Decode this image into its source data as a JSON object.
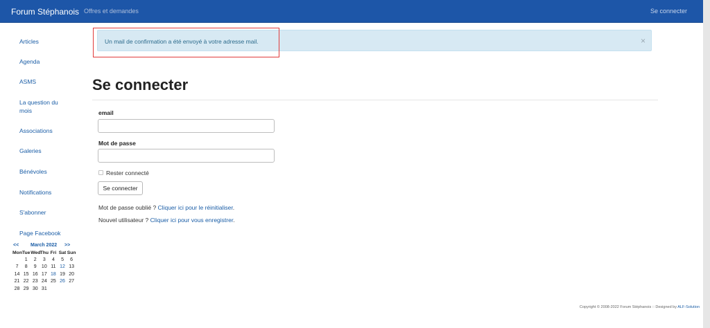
{
  "navbar": {
    "brand": "Forum Stéphanois",
    "link_offres": "Offres et demandes",
    "link_login": "Se connecter"
  },
  "sidebar": {
    "items": [
      {
        "label": "Articles"
      },
      {
        "label": "Agenda"
      },
      {
        "label": "ASMS"
      },
      {
        "label": "La question du mois"
      },
      {
        "label": "Associations"
      },
      {
        "label": "Galeries"
      },
      {
        "label": "Bénévoles"
      },
      {
        "label": "Notifications"
      },
      {
        "label": "S'abonner"
      },
      {
        "label": "Page Facebook"
      }
    ]
  },
  "calendar": {
    "prev": "<<",
    "title": "March 2022",
    "next": ">>",
    "weekdays": [
      "Mon",
      "Tue",
      "Wed",
      "Thu",
      "Fri",
      "Sat",
      "Sun"
    ],
    "weeks": [
      [
        "",
        "1",
        "2",
        "3",
        "4",
        "5",
        "6"
      ],
      [
        "7",
        "8",
        "9",
        "10",
        "11",
        "12",
        "13"
      ],
      [
        "14",
        "15",
        "16",
        "17",
        "18",
        "19",
        "20"
      ],
      [
        "21",
        "22",
        "23",
        "24",
        "25",
        "26",
        "27"
      ],
      [
        "28",
        "29",
        "30",
        "31",
        "",
        "",
        ""
      ]
    ],
    "linked_days": [
      "12",
      "18",
      "26"
    ]
  },
  "alert": {
    "message": "Un mail de confirmation a été envoyé à votre adresse mail.",
    "close": "×"
  },
  "main": {
    "title": "Se connecter",
    "email_label": "email",
    "email_value": "",
    "password_label": "Mot de passe",
    "password_value": "",
    "remember_label": "Rester connecté",
    "submit_label": "Se connecter",
    "forgot_prefix": "Mot de passe oublié ?",
    "forgot_link": "Cliquer ici pour le réinitialiser",
    "forgot_suffix": ".",
    "new_prefix": "Nouvel utilisateur ?",
    "new_link": "Cliquer ici pour vous enregistrer",
    "new_suffix": "."
  },
  "footer": {
    "text": "Copyright © 2008-2022 Forum Stéphanois :: Designed by",
    "link": "ALF-Solution"
  },
  "colors": {
    "navbar": "#1d56a8",
    "link": "#1a5da6",
    "alert_bg": "#d7e9f3",
    "highlight": "#e03a3a"
  }
}
